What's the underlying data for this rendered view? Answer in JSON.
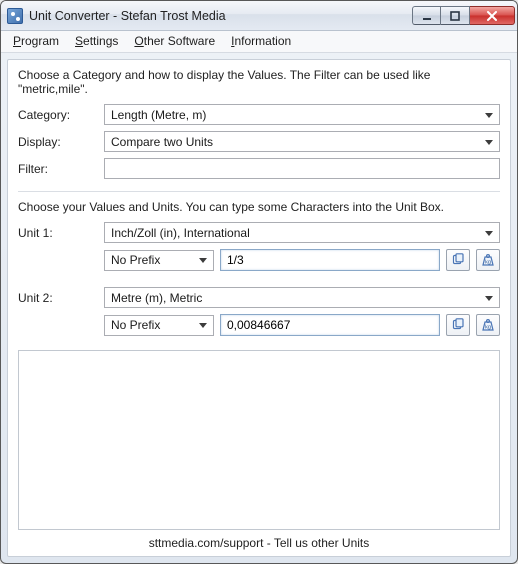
{
  "window": {
    "title": "Unit Converter - Stefan Trost Media"
  },
  "menus": {
    "program": "Program",
    "settings": "Settings",
    "other_software": "Other Software",
    "information": "Information"
  },
  "section1": {
    "hint": "Choose a Category and how to display the Values. The Filter can be used like \"metric,mile\".",
    "labels": {
      "category": "Category:",
      "display": "Display:",
      "filter": "Filter:"
    },
    "category_value": "Length (Metre, m)",
    "display_value": "Compare two Units",
    "filter_value": ""
  },
  "section2": {
    "hint": "Choose your Values and Units. You can type some Characters into the Unit Box.",
    "labels": {
      "unit1": "Unit 1:",
      "unit2": "Unit 2:"
    },
    "unit1": {
      "unit": "Inch/Zoll (in), International",
      "prefix": "No Prefix",
      "value": "1/3"
    },
    "unit2": {
      "unit": "Metre (m), Metric",
      "prefix": "No Prefix",
      "value": "0,00846667"
    }
  },
  "footer": "sttmedia.com/support - Tell us other Units",
  "icons": {
    "copy": "copy-icon",
    "unit": "kg-icon"
  }
}
